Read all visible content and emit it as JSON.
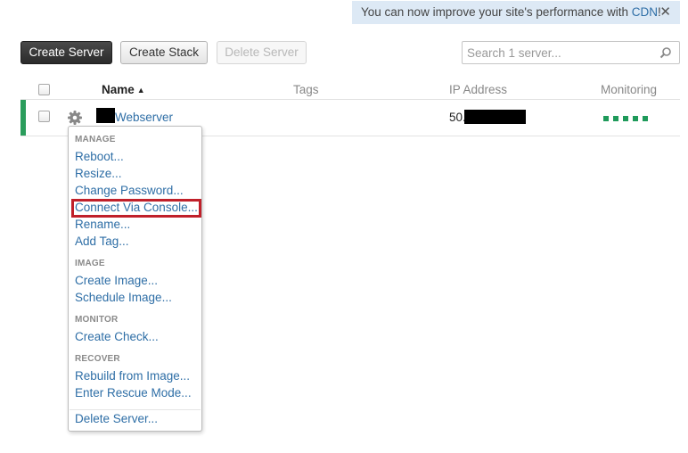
{
  "notice": {
    "text": "You can now improve your site's performance with ",
    "link": "CDN",
    "suffix": "!",
    "close": "✕"
  },
  "toolbar": {
    "create_server": "Create Server",
    "create_stack": "Create Stack",
    "delete_server": "Delete Server"
  },
  "search": {
    "placeholder": "Search 1 server...",
    "value": ""
  },
  "table": {
    "headers": {
      "name": "Name",
      "sort_indicator": "▲",
      "tags": "Tags",
      "ip": "IP Address",
      "monitoring": "Monitoring"
    },
    "rows": [
      {
        "name": "Webserver",
        "ip_prefix": "50.",
        "monitoring_status": "ok",
        "monitoring_dots": 5
      }
    ]
  },
  "menu": {
    "sections": [
      {
        "title": "MANAGE",
        "items": [
          "Reboot...",
          "Resize...",
          "Change Password...",
          "Connect Via Console...",
          "Rename...",
          "Add Tag..."
        ]
      },
      {
        "title": "IMAGE",
        "items": [
          "Create Image...",
          "Schedule Image..."
        ]
      },
      {
        "title": "MONITOR",
        "items": [
          "Create Check..."
        ]
      },
      {
        "title": "RECOVER",
        "items": [
          "Rebuild from Image...",
          "Enter Rescue Mode..."
        ]
      }
    ],
    "footer_item": "Delete Server...",
    "highlighted_item": "Connect Via Console..."
  },
  "colors": {
    "accent_green": "#2a9d5c",
    "link_blue": "#2e6ea6",
    "highlight_red": "#c0202a",
    "notice_bg": "#dde9f5"
  },
  "icons": {
    "gear": "gear-icon",
    "search": "search-icon",
    "close": "close-icon",
    "sort": "sort-ascending-icon"
  }
}
